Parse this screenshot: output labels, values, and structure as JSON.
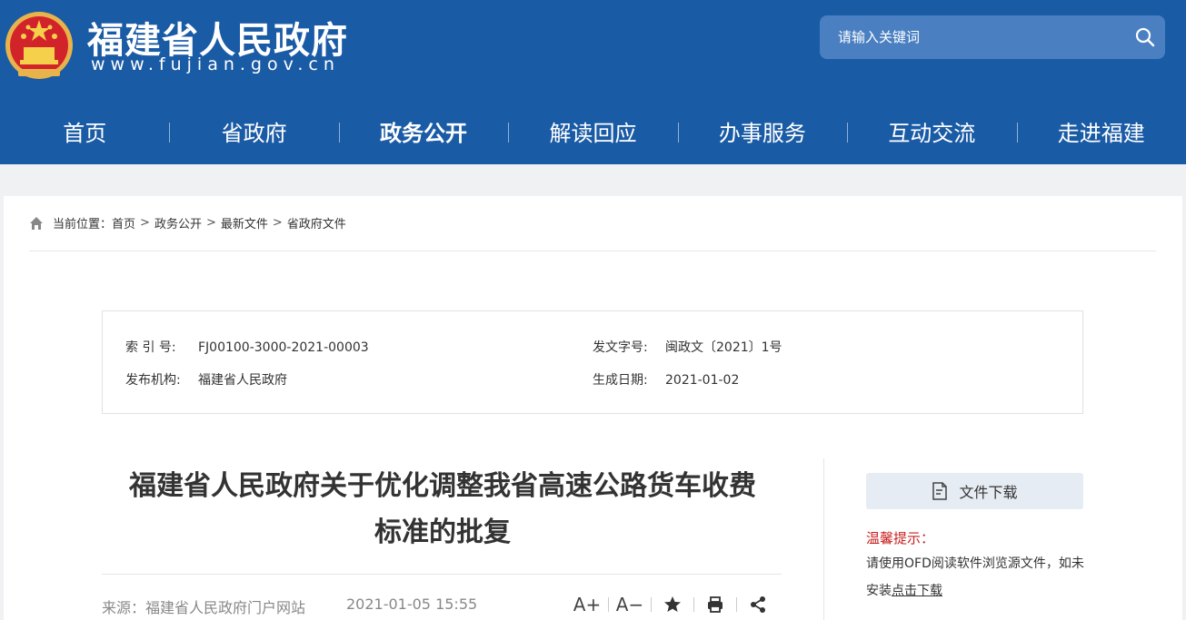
{
  "header": {
    "site_title": "福建省人民政府",
    "site_url": "www.fujian.gov.cn",
    "search_placeholder": "请输入关键词",
    "bg_color": "#1a5ba5"
  },
  "nav": {
    "items": [
      {
        "label": "首页"
      },
      {
        "label": "省政府"
      },
      {
        "label": "政务公开"
      },
      {
        "label": "解读回应"
      },
      {
        "label": "办事服务"
      },
      {
        "label": "互动交流"
      },
      {
        "label": "走进福建"
      }
    ],
    "active": "政务公开"
  },
  "breadcrumb": {
    "prefix": "当前位置：",
    "items": [
      "首页",
      "政务公开",
      "最新文件",
      "省政府文件"
    ],
    "separator": ">"
  },
  "meta": {
    "index_label": "索 引 号:",
    "index_value": "FJ00100-3000-2021-00003",
    "doc_no_label": "发文字号:",
    "doc_no_value": "闽政文〔2021〕1号",
    "issuer_label": "发布机构:",
    "issuer_value": "福建省人民政府",
    "date_label": "生成日期:",
    "date_value": "2021-01-02"
  },
  "article": {
    "title_line1": "福建省人民政府关于优化调整我省高速公路货车收费",
    "title_line2": "标准的批复",
    "source": "来源：福建省人民政府门户网站",
    "datetime": "2021-01-05 15:55",
    "font_larger": "A+",
    "font_smaller": "A−"
  },
  "sidebar": {
    "download_label": "文件下载",
    "tip_title": "温馨提示：",
    "tip_text": "请使用OFD阅读软件浏览源文件，如未安装",
    "tip_link": "点击下载",
    "tip_color": "#c81f1f"
  },
  "icons": [
    "emblem",
    "search-icon",
    "home-icon",
    "file-download-icon",
    "star-icon",
    "print-icon",
    "share-icon"
  ]
}
